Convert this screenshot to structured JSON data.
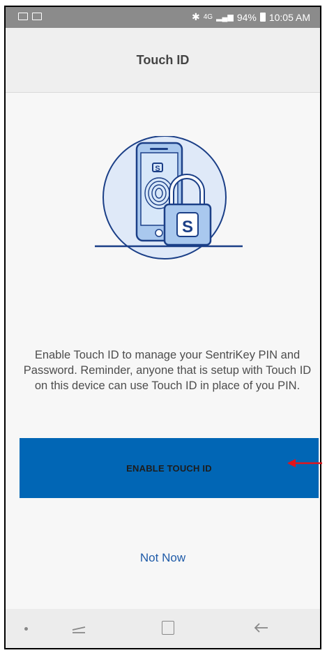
{
  "status_bar": {
    "left_icons": [
      "email-icon",
      "image-icon"
    ],
    "bluetooth": "✱",
    "network": "4G",
    "battery": "94%",
    "time": "10:05 AM"
  },
  "header": {
    "title": "Touch ID"
  },
  "illustration": {
    "icon": "phone-fingerprint-lock-icon"
  },
  "message": {
    "text": "Enable Touch ID to manage your SentriKey PIN and Password. Reminder, anyone that is setup with Touch ID on this device can use Touch ID in place of you PIN."
  },
  "buttons": {
    "enable_label": "ENABLE TOUCH ID",
    "not_now_label": "Not Now"
  },
  "annotation": {
    "arrow_color": "#e3141b"
  },
  "nav_bar": {
    "icons": [
      "dot-icon",
      "recent-apps-icon",
      "home-icon",
      "back-icon"
    ]
  },
  "colors": {
    "accent": "#0166b5",
    "link": "#1f5ba8",
    "status_bar": "#8b8b8b"
  }
}
